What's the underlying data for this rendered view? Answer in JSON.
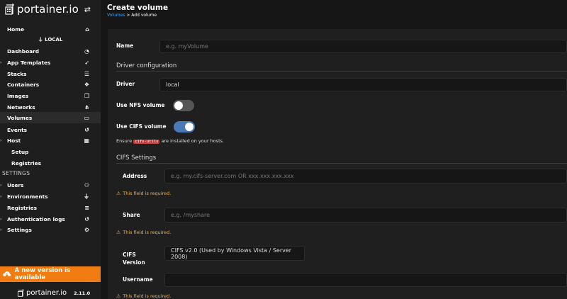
{
  "sidebar": {
    "brand": "portainer.io",
    "environment": "LOCAL",
    "items": [
      {
        "label": "Home",
        "icon": "home-icon"
      },
      {
        "label": "Dashboard",
        "icon": "tachometer-icon"
      },
      {
        "label": "App Templates",
        "icon": "rocket-icon"
      },
      {
        "label": "Stacks",
        "icon": "list-icon"
      },
      {
        "label": "Containers",
        "icon": "cubes-icon"
      },
      {
        "label": "Images",
        "icon": "clone-icon"
      },
      {
        "label": "Networks",
        "icon": "sitemap-icon"
      },
      {
        "label": "Volumes",
        "icon": "hdd-icon"
      },
      {
        "label": "Events",
        "icon": "history-icon"
      },
      {
        "label": "Host",
        "icon": "th-icon"
      },
      {
        "label": "Setup"
      },
      {
        "label": "Registries"
      }
    ],
    "settings_label": "SETTINGS",
    "settings_items": [
      {
        "label": "Users",
        "icon": "users-icon"
      },
      {
        "label": "Environments",
        "icon": "plug-icon"
      },
      {
        "label": "Registries",
        "icon": "database-icon"
      },
      {
        "label": "Authentication logs",
        "icon": "history-icon"
      },
      {
        "label": "Settings",
        "icon": "cogs-icon"
      }
    ],
    "update_banner": "A new version is available",
    "footer_brand": "portainer.io",
    "version": "2.11.0"
  },
  "header": {
    "title": "Create volume",
    "breadcrumb_link": "Volumes",
    "breadcrumb_current": "> Add volume"
  },
  "form": {
    "name_label": "Name",
    "name_placeholder": "e.g. myVolume",
    "driver_section": "Driver configuration",
    "driver_label": "Driver",
    "driver_value": "local",
    "nfs_label": "Use NFS volume",
    "nfs_enabled": false,
    "cifs_label": "Use CIFS volume",
    "cifs_enabled": true,
    "ensure_prefix": "Ensure",
    "ensure_code": "cifs-utils",
    "ensure_suffix": "are installed on your hosts.",
    "cifs_section": "CIFS Settings",
    "address_label": "Address",
    "address_placeholder": "e.g. my.cifs-server.com OR xxx.xxx.xxx.xxx",
    "address_error": "This field is required.",
    "share_label": "Share",
    "share_placeholder": "e.g. /myshare",
    "share_error": "This field is required.",
    "cifs_version_label_1": "CIFS",
    "cifs_version_label_2": "Version",
    "cifs_version_value": "CIFS v2.0 (Used by Windows Vista / Server 2008)",
    "username_label": "Username",
    "username_error": "This field is required."
  },
  "colors": {
    "accent_orange": "#f07c12",
    "link_blue": "#3fa0f0",
    "warning": "#f0b04b",
    "toggle_on": "#4a7ab5"
  }
}
